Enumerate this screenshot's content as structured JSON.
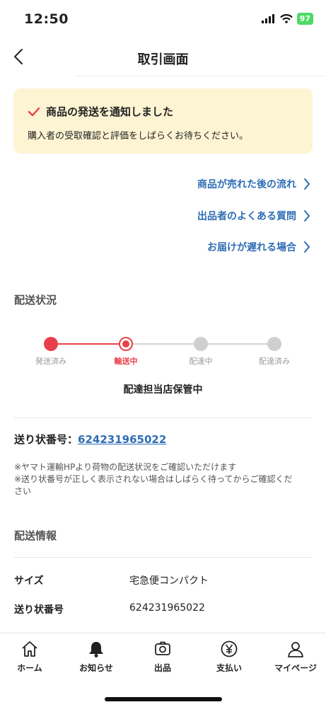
{
  "status_bar": {
    "time": "12:50",
    "battery": "97"
  },
  "header": {
    "title": "取引画面"
  },
  "notice": {
    "title": "商品の発送を通知しました",
    "body": "購入者の受取確認と評価をしばらくお待ちください。"
  },
  "links": [
    {
      "label": "商品が売れた後の流れ"
    },
    {
      "label": "出品者のよくある質問"
    },
    {
      "label": "お届けが遅れる場合"
    }
  ],
  "shipping_status": {
    "section_title": "配送状況",
    "steps": [
      {
        "label": "発送済み",
        "state": "done"
      },
      {
        "label": "輸送中",
        "state": "current"
      },
      {
        "label": "配達中",
        "state": "todo"
      },
      {
        "label": "配達済み",
        "state": "todo"
      }
    ],
    "status_text": "配達担当店保管中",
    "tracking_label": "送り状番号：",
    "tracking_number": "624231965022",
    "notes": [
      "※ヤマト運輸HPより荷物の配送状況をご確認いただけます",
      "※送り状番号が正しく表示されない場合はしばらく待ってからご確認ください"
    ]
  },
  "shipping_info": {
    "section_title": "配送情報",
    "rows": [
      {
        "label": "サイズ",
        "value": "宅急便コンパクト"
      },
      {
        "label": "送り状番号",
        "value": "624231965022"
      }
    ]
  },
  "tab_bar": [
    {
      "label": "ホーム",
      "icon": "home-icon"
    },
    {
      "label": "お知らせ",
      "icon": "bell-icon"
    },
    {
      "label": "出品",
      "icon": "camera-icon"
    },
    {
      "label": "支払い",
      "icon": "yen-icon"
    },
    {
      "label": "マイページ",
      "icon": "person-icon"
    }
  ],
  "colors": {
    "accent": "#e8404a",
    "link": "#2f6db5",
    "notice_bg": "#fdf4d3"
  }
}
